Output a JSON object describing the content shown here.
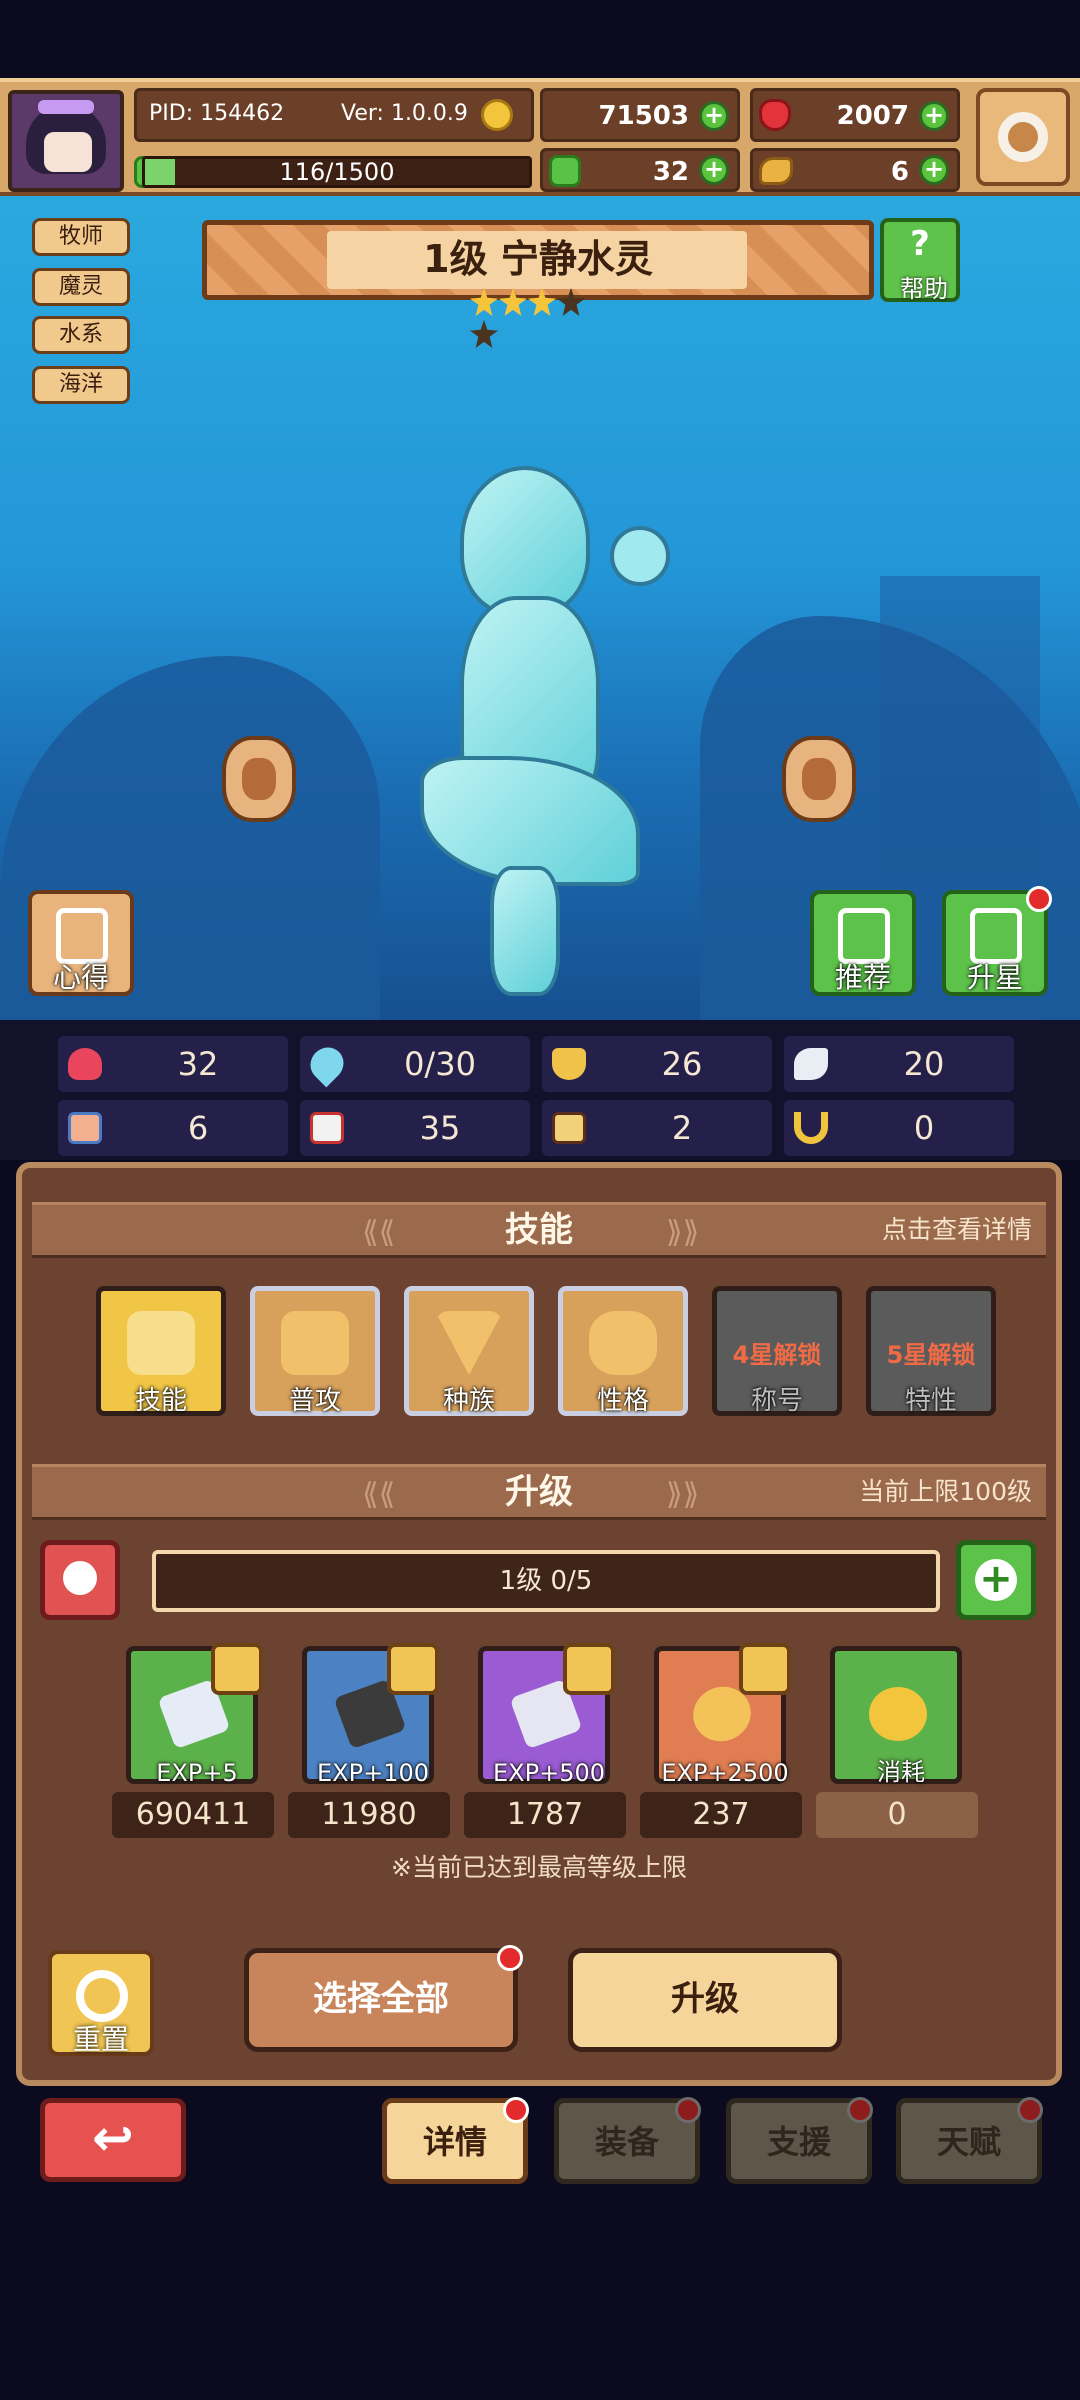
{
  "header": {
    "pid": "PID: 154462",
    "version": "Ver: 1.0.0.9",
    "gold": "71503",
    "gems": "2007",
    "exp_text": "116/1500",
    "exp_fraction": 0.077,
    "clover": "32",
    "food": "6"
  },
  "tags": [
    "牧师",
    "魔灵",
    "水系",
    "海洋"
  ],
  "title": "1级  宁静水灵",
  "stars": {
    "filled": 3,
    "total": 5
  },
  "help_label": "帮助",
  "scene_buttons": {
    "notes": "心得",
    "recommend": "推荐",
    "star_up": "升星"
  },
  "stats": {
    "row1": [
      "32",
      "0/30",
      "26",
      "20"
    ],
    "row2": [
      "6",
      "35",
      "2",
      "0"
    ]
  },
  "skills_section": {
    "title": "技能",
    "hint": "点击查看详情",
    "items": [
      {
        "label": "技能",
        "lock": ""
      },
      {
        "label": "普攻",
        "lock": ""
      },
      {
        "label": "种族",
        "lock": ""
      },
      {
        "label": "性格",
        "lock": ""
      },
      {
        "label": "称号",
        "lock": "4星解锁"
      },
      {
        "label": "特性",
        "lock": "5星解锁"
      }
    ]
  },
  "upgrade_section": {
    "title": "升级",
    "hint": "当前上限100级",
    "level_text": "1级  0/5",
    "items": [
      {
        "label": "EXP+5",
        "count": "690411"
      },
      {
        "label": "EXP+100",
        "count": "11980"
      },
      {
        "label": "EXP+500",
        "count": "1787"
      },
      {
        "label": "EXP+2500",
        "count": "237"
      },
      {
        "label": "消耗",
        "count": "0"
      }
    ],
    "max_note": "※当前已达到最高等级上限"
  },
  "actions": {
    "reset": "重置",
    "select_all": "选择全部",
    "upgrade": "升级"
  },
  "tabs": [
    "详情",
    "装备",
    "支援",
    "天赋"
  ],
  "colors": {
    "accent_green": "#5bc43f",
    "accent_red": "#e32b2b",
    "panel_brown": "#6c4331",
    "gold": "#f0c555"
  }
}
